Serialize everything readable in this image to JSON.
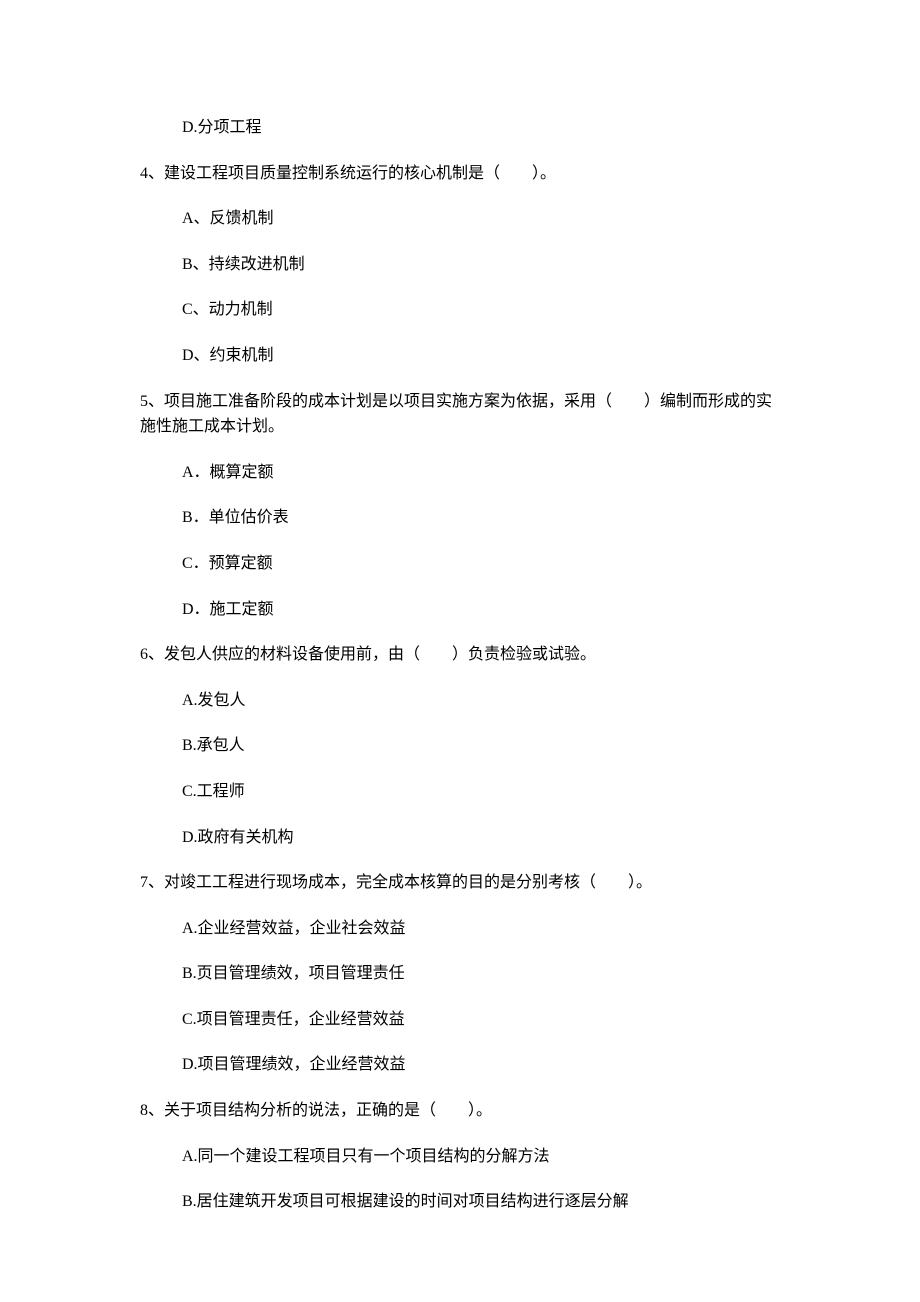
{
  "pre_option": "D.分项工程",
  "q4": {
    "stem": "4、建设工程项目质量控制系统运行的核心机制是（　　）。",
    "A": "A、反馈机制",
    "B": "B、持续改进机制",
    "C": "C、动力机制",
    "D": "D、约束机制"
  },
  "q5": {
    "stem": "5、项目施工准备阶段的成本计划是以项目实施方案为依据，采用（　　）编制而形成的实施性施工成本计划。",
    "A": "A．概算定额",
    "B": "B．单位估价表",
    "C": "C．预算定额",
    "D": "D．施工定额"
  },
  "q6": {
    "stem": "6、发包人供应的材料设备使用前，由（　　）负责检验或试验。",
    "A": "A.发包人",
    "B": "B.承包人",
    "C": "C.工程师",
    "D": "D.政府有关机构"
  },
  "q7": {
    "stem": "7、对竣工工程进行现场成本，完全成本核算的目的是分别考核（　　）。",
    "A": "A.企业经营效益，企业社会效益",
    "B": "B.页目管理绩效，项目管理责任",
    "C": "C.项目管理责任，企业经营效益",
    "D": "D.项目管理绩效，企业经营效益"
  },
  "q8": {
    "stem": "8、关于项目结构分析的说法，正确的是（　　）。",
    "A": "A.同一个建设工程项目只有一个项目结构的分解方法",
    "B": "B.居住建筑开发项目可根据建设的时间对项目结构进行逐层分解"
  }
}
